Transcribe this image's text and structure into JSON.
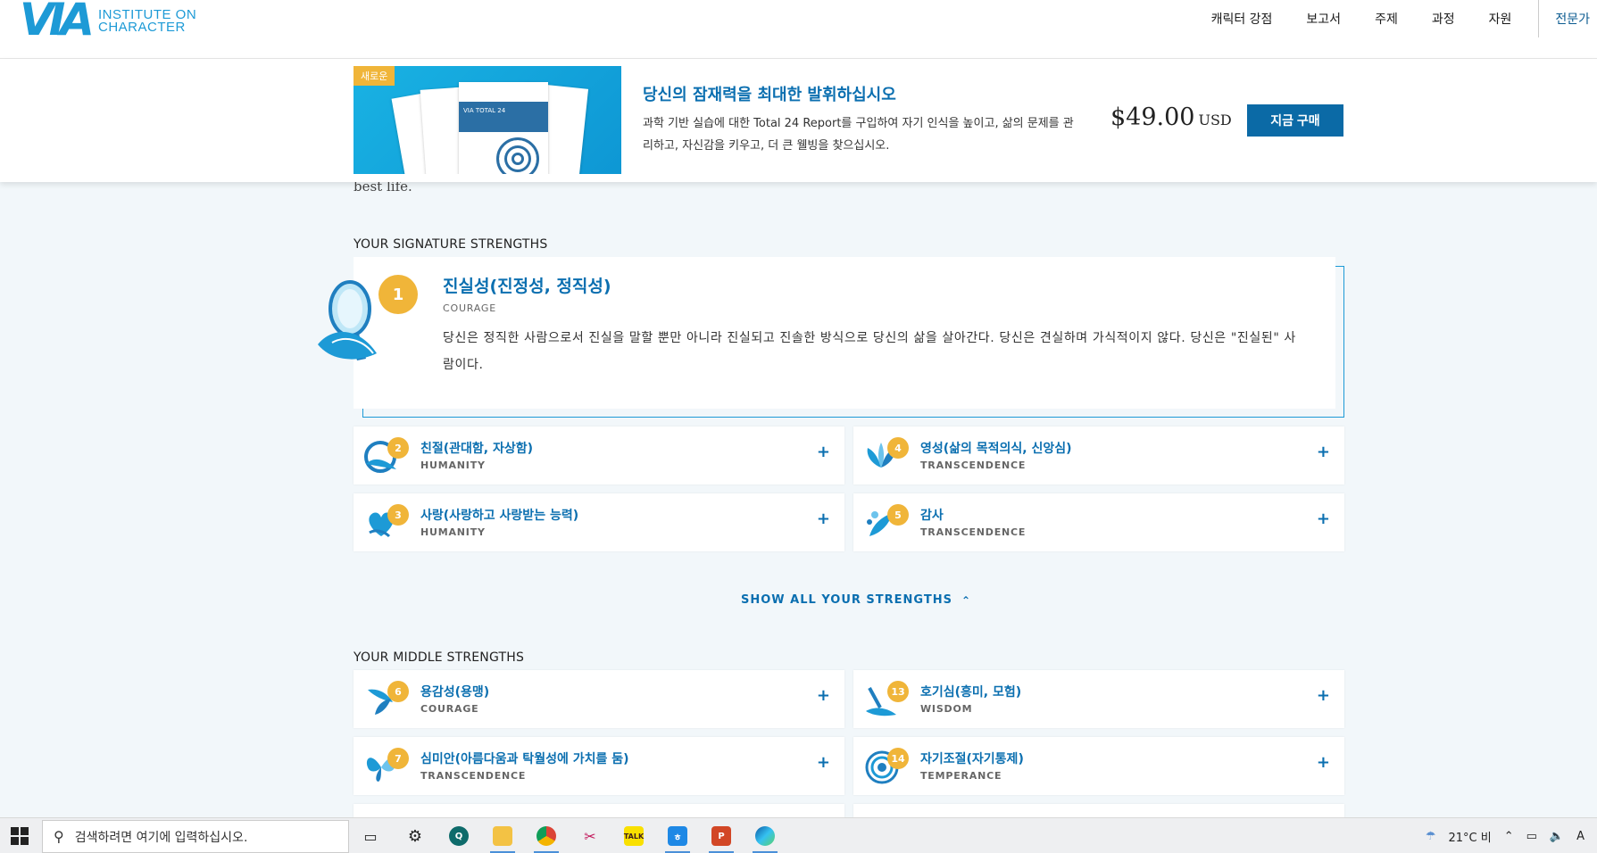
{
  "nav": {
    "logo_mark": "VIA",
    "logo_line1": "INSTITUTE ON",
    "logo_line2": "CHARACTER",
    "links": [
      "캐릭터 강점",
      "보고서",
      "주제",
      "과정",
      "자원"
    ],
    "pro_link": "전문가"
  },
  "promo": {
    "badge": "새로운",
    "image_caption": "VIA TOTAL 24",
    "title": "당신의 잠재력을 최대한 발휘하십시오",
    "description": "과학 기반 실습에 대한 Total 24 Report를 구입하여 자기 인식을 높이고, 삶의 문제를 관리하고, 자신감을 키우고, 더 큰 웰빙을 찾으십시오.",
    "price": "$49.00",
    "currency": "USD",
    "buy_label": "지금 구매"
  },
  "page": {
    "faded_text": "best life.",
    "signature_heading": "YOUR SIGNATURE STRENGTHS",
    "middle_heading": "YOUR MIDDLE STRENGTHS",
    "show_all": "SHOW ALL YOUR STRENGTHS"
  },
  "top_strength": {
    "rank": "1",
    "title": "진실성(진정성, 정직성)",
    "category": "COURAGE",
    "description": "당신은 정직한 사람으로서 진실을 말할 뿐만 아니라 진실되고 진솔한 방식으로 당신의 삶을 살아간다. 당신은 견실하며 가식적이지 않다. 당신은 \"진실된\" 사람이다."
  },
  "signature_cards": [
    {
      "rank": "2",
      "title": "친절(관대함, 자상함)",
      "category": "HUMANITY"
    },
    {
      "rank": "4",
      "title": "영성(삶의 목적의식, 신앙심)",
      "category": "TRANSCENDENCE"
    },
    {
      "rank": "3",
      "title": "사랑(사랑하고 사랑받는 능력)",
      "category": "HUMANITY"
    },
    {
      "rank": "5",
      "title": "감사",
      "category": "TRANSCENDENCE"
    }
  ],
  "middle_cards": [
    {
      "rank": "6",
      "title": "용감성(용맹)",
      "category": "COURAGE"
    },
    {
      "rank": "13",
      "title": "호기심(흥미, 모험)",
      "category": "WISDOM"
    },
    {
      "rank": "7",
      "title": "심미안(아름다움과 탁월성에 가치를 둠)",
      "category": "TRANSCENDENCE"
    },
    {
      "rank": "14",
      "title": "자기조절(자기통제)",
      "category": "TEMPERANCE"
    }
  ],
  "taskbar": {
    "search_placeholder": "검색하려면 여기에 입력하십시오.",
    "weather": "21°C  비",
    "lang": "A"
  },
  "colors": {
    "accent": "#0b6fb0",
    "badge": "#f0b539",
    "bg": "#f2f7fa"
  }
}
